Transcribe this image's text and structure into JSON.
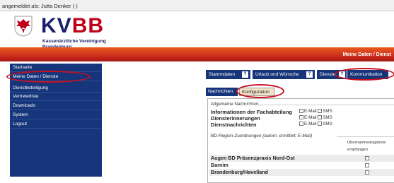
{
  "topbar": {
    "login_text": "angemeldet als: Jutta Denker ( )"
  },
  "brand": {
    "name_kv": "KV",
    "name_bb": "BB",
    "subtitle_line1": "Kassenärztliche Vereinigung",
    "subtitle_line2": "Brandenburg",
    "colors": {
      "navy": "#1a1f6b",
      "red": "#c00018",
      "sidebar": "#16357a",
      "band": "#c6261b"
    }
  },
  "header_band": {
    "breadcrumb": "Meine Daten / Dienst"
  },
  "sidebar": {
    "items": [
      {
        "label": "Startseite"
      },
      {
        "label": "Meine Daten / Dienste"
      },
      {
        "label": "Dienstbeteiligung"
      },
      {
        "label": "Vertreterliste"
      },
      {
        "label": "Downloads"
      },
      {
        "label": "System"
      },
      {
        "label": "Logout"
      }
    ]
  },
  "tabs": [
    {
      "label": "Stammdaten"
    },
    {
      "label": "Urlaub und Wünsche"
    },
    {
      "label": "Dienste"
    },
    {
      "label": "Kommunikation"
    }
  ],
  "subtabs": [
    {
      "label": "Nachrichten"
    },
    {
      "label": "Konfiguration"
    }
  ],
  "general": {
    "legend": "Allgemeine Nachrichten",
    "rows": [
      {
        "label": "Informationen der Fachabteilung",
        "email": "E-Mail",
        "sms": "SMS"
      },
      {
        "label": "Diensterinnerungen",
        "email": "E-Mail",
        "sms": "SMS"
      },
      {
        "label": "Dienstnachrichten",
        "email": "E-Mail",
        "sms": "SMS"
      }
    ]
  },
  "regions": {
    "legend_prefix": "BD-Region-Zuordnungen",
    "legend_suffix": "(autom. ermittelt; E-Mail)",
    "column_header_line1": "Übernahmeangebote",
    "column_header_line2": "empfangen",
    "rows": [
      {
        "label": "Augen BD Präsenzpraxis Nord-Ost"
      },
      {
        "label": "Barnim"
      },
      {
        "label": "Brandenburg/Havelland"
      }
    ]
  }
}
